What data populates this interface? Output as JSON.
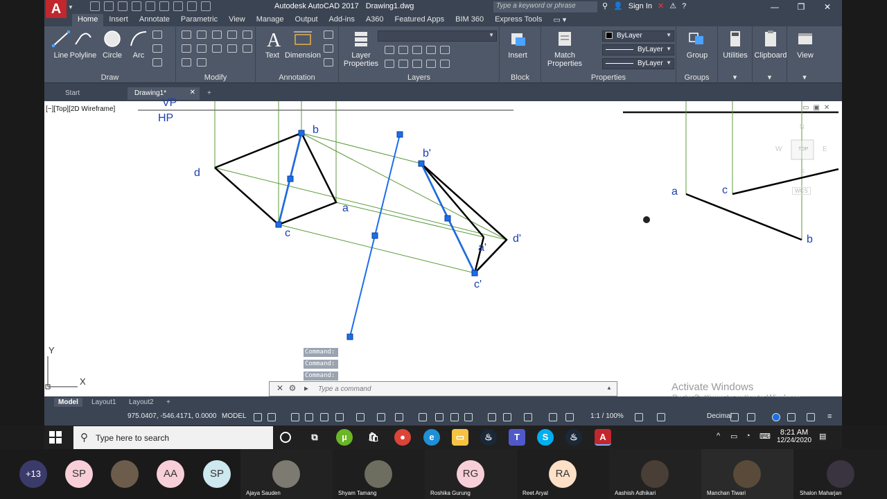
{
  "app": {
    "title": "Autodesk AutoCAD 2017",
    "document": "Drawing1.dwg",
    "logo_letter": "A",
    "search_placeholder": "Type a keyword or phrase",
    "sign_in": "Sign In"
  },
  "ribbon_tabs": [
    "Home",
    "Insert",
    "Annotate",
    "Parametric",
    "View",
    "Manage",
    "Output",
    "Add-ins",
    "A360",
    "Featured Apps",
    "BIM 360",
    "Express Tools"
  ],
  "active_ribbon_tab": "Home",
  "ribbon": {
    "draw_tools": [
      "Line",
      "Polyline",
      "Circle",
      "Arc"
    ],
    "draw_title": "Draw",
    "modify_title": "Modify",
    "annotation_tools": [
      "Text",
      "Dimension"
    ],
    "annotation_title": "Annotation",
    "layer_properties": [
      "Layer",
      "Properties"
    ],
    "layers_title": "Layers",
    "insert_label": "Insert",
    "block_title": "Block",
    "match_properties": [
      "Match",
      "Properties"
    ],
    "bylayer_values": [
      "ByLayer",
      "ByLayer",
      "ByLayer"
    ],
    "properties_title": "Properties",
    "group_label": "Group",
    "groups_title": "Groups",
    "utilities": "Utilities",
    "clipboard": "Clipboard",
    "view": "View"
  },
  "doc_tabs": [
    "Start",
    "Drawing1*"
  ],
  "viewport_label": "[−][Top][2D Wireframe]",
  "drawing": {
    "labels": {
      "vp": "VP",
      "hp": "HP",
      "b": "b",
      "d": "d",
      "a": "a",
      "c": "c",
      "b_prime": "b'",
      "a_prime": "a'",
      "c_prime": "c'",
      "d_prime": "d'",
      "side_a": "a",
      "side_c": "c",
      "side_b": "b"
    },
    "viewcube": {
      "n": "N",
      "w": "W",
      "top": "TOP",
      "e": "E",
      "s": "S",
      "wcs": "WCS"
    },
    "ucs": {
      "y": "Y",
      "x": "X"
    }
  },
  "command": {
    "history": [
      "Command:",
      "Command:",
      "Command:"
    ],
    "placeholder": "Type a command"
  },
  "activate_windows": {
    "line1": "Activate Windows",
    "line2": "Go to Settings to activate Windows."
  },
  "layout_tabs": [
    "Model",
    "Layout1",
    "Layout2"
  ],
  "status": {
    "coords": "975.0407, -546.4171, 0.0000",
    "space": "MODEL",
    "scale": "1:1 / 100%",
    "units": "Decimal"
  },
  "taskbar": {
    "search_placeholder": "Type here to search",
    "time": "8:21 AM",
    "date": "12/24/2020"
  },
  "participants": [
    {
      "initials": "+13"
    },
    {
      "initials": "SP"
    },
    {
      "name": ""
    },
    {
      "initials": "AA"
    },
    {
      "initials": "SP"
    },
    {
      "name": "Ajaya Sauden"
    },
    {
      "name": "Shyam Tamang"
    },
    {
      "initials": "RG",
      "name": "Roshika Gurung"
    },
    {
      "initials": "RA",
      "name": "Reet Aryal"
    },
    {
      "name": "Aashish Adhikari"
    },
    {
      "name": "Manchan Tiwari"
    },
    {
      "name": "Shalon Maharjan"
    }
  ],
  "colors": {
    "acad_red": "#c1272d",
    "ribbon_bg": "#4f5868",
    "titlebar_bg": "#3b4453",
    "label_blue": "#1b3fb0",
    "grip_blue": "#1c6ee8",
    "projector_green": "#5c9a3c"
  }
}
